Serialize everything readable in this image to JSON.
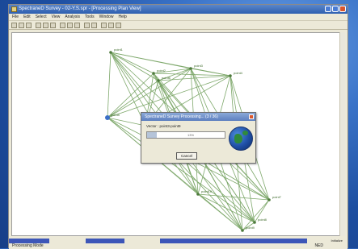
{
  "window": {
    "title": "SpectraneD Survey - 02-Y.S.spr - [Processing Plan View]"
  },
  "menu": [
    "File",
    "Edit",
    "Select",
    "View",
    "Analysis",
    "Tools",
    "Window",
    "Help"
  ],
  "canvas": {
    "nodes": [
      {
        "label": "point1"
      },
      {
        "label": "point2"
      },
      {
        "label": "point3"
      },
      {
        "label": "point4"
      },
      {
        "label": "point5"
      },
      {
        "label": "point6"
      },
      {
        "label": "point7"
      },
      {
        "label": "point8"
      },
      {
        "label": "point9"
      },
      {
        "label": "point10"
      },
      {
        "label": "point11"
      }
    ]
  },
  "dialog": {
    "title": "SpectraneD Survey Processing... (3 / 36)",
    "vector_text": "Vector : point3-point9",
    "progress_percent": 0.13,
    "progress_label": "13%",
    "cancel_label": "Cancel"
  },
  "status": {
    "mode": "Processing Mode",
    "right": "NED",
    "pane": "Initialize"
  }
}
